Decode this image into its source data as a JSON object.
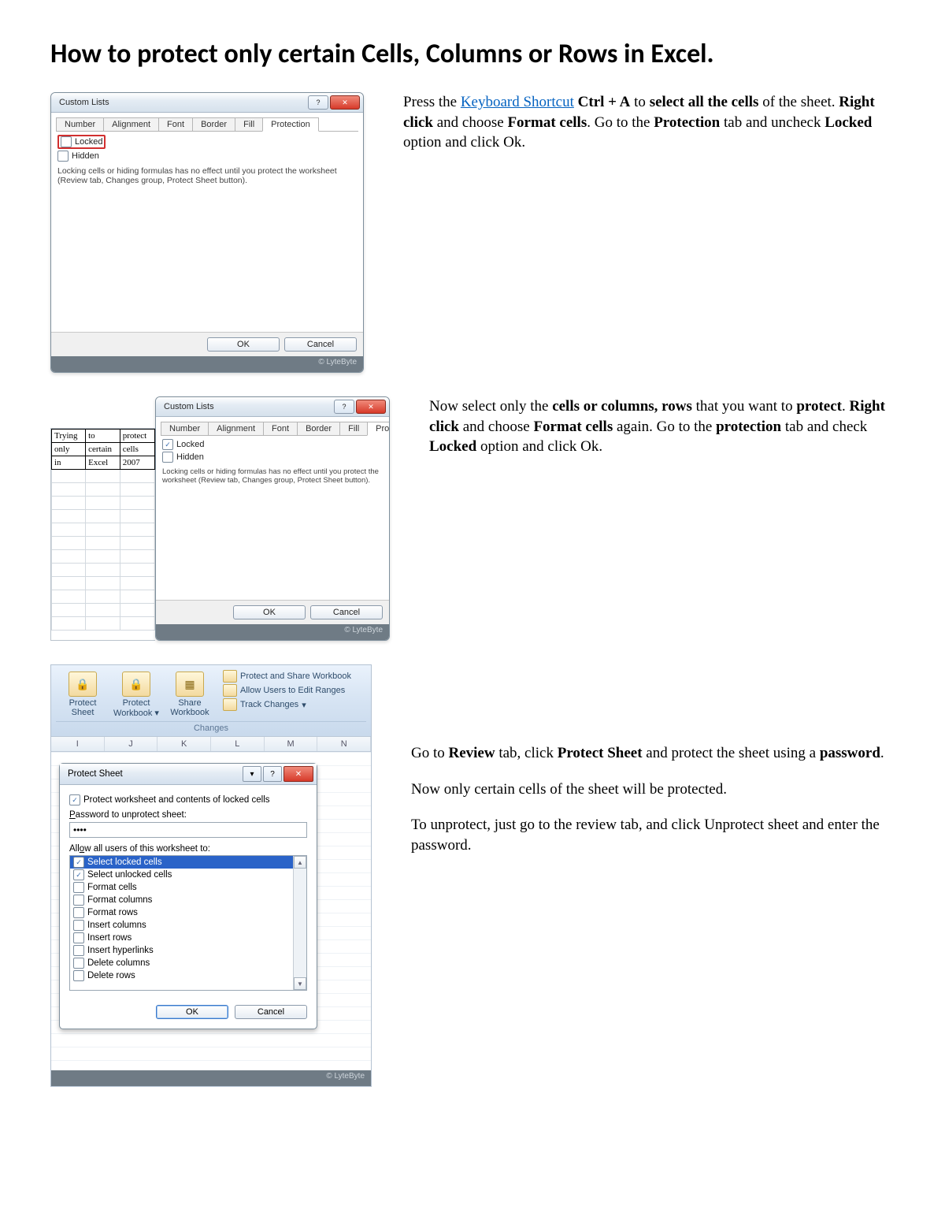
{
  "title": "How to protect only certain Cells, Columns or Rows in Excel.",
  "step1_text": {
    "prefix": "Press the ",
    "link": "Keyboard Shortcut",
    "b1": "Ctrl + A",
    "t1": " to ",
    "b2": "select all the cells",
    "t2": " of the sheet. ",
    "b3": "Right click",
    "t3": " and choose ",
    "b4": "Format cells",
    "t4": ". Go to the ",
    "b5": "Protection",
    "t5": " tab and uncheck ",
    "b6": "Locked",
    "t6": " option and click Ok."
  },
  "step2_text": {
    "t0": "Now select only the ",
    "b1": "cells or columns, rows",
    "t1": " that you want to ",
    "b2": "protect",
    "t2": ". ",
    "b3": "Right click",
    "t3": " and choose ",
    "b4": "Format cells",
    "t4": " again. Go to the ",
    "b5": "protection",
    "t5": " tab and check ",
    "b6": "Locked",
    "t6": " option and click Ok."
  },
  "step3_text": {
    "p1a": "Go to ",
    "p1b1": "Review",
    "p1b": " tab, click ",
    "p1b2": "Protect Sheet",
    "p1c": " and protect the sheet using a ",
    "p1b3": "password",
    "p1d": ".",
    "p2": "Now only certain cells of the sheet will be protected.",
    "p3": "To unprotect, just go to the review tab, and click Unprotect sheet and enter the password."
  },
  "dialog": {
    "title": "Custom Lists",
    "tabs": [
      "Number",
      "Alignment",
      "Font",
      "Border",
      "Fill",
      "Protection"
    ],
    "locked": "Locked",
    "hidden": "Hidden",
    "note": "Locking cells or hiding formulas has no effect until you protect the worksheet (Review tab, Changes group, Protect Sheet button).",
    "ok": "OK",
    "cancel": "Cancel"
  },
  "watermark": "© LyteByte",
  "mini_sheet": [
    [
      "Trying",
      "to",
      "protect"
    ],
    [
      "only",
      "certain",
      "cells"
    ],
    [
      "in",
      "Excel",
      "2007"
    ]
  ],
  "ribbon": {
    "protect_sheet": "Protect Sheet",
    "protect_wb": "Protect Workbook",
    "share_wb": "Share Workbook",
    "side1": "Protect and Share Workbook",
    "side2": "Allow Users to Edit Ranges",
    "side3": "Track Changes",
    "group": "Changes",
    "cols": [
      "I",
      "J",
      "K",
      "L",
      "M",
      "N"
    ]
  },
  "protect_sheet": {
    "title": "Protect Sheet",
    "toggle": "Protect worksheet and contents of locked cells",
    "pw_label": "Password to unprotect sheet:",
    "pw_value": "••••",
    "allow_label": "Allow all users of this worksheet to:",
    "perms": [
      {
        "label": "Select locked cells",
        "checked": true,
        "selected": true
      },
      {
        "label": "Select unlocked cells",
        "checked": true,
        "selected": false
      },
      {
        "label": "Format cells",
        "checked": false,
        "selected": false
      },
      {
        "label": "Format columns",
        "checked": false,
        "selected": false
      },
      {
        "label": "Format rows",
        "checked": false,
        "selected": false
      },
      {
        "label": "Insert columns",
        "checked": false,
        "selected": false
      },
      {
        "label": "Insert rows",
        "checked": false,
        "selected": false
      },
      {
        "label": "Insert hyperlinks",
        "checked": false,
        "selected": false
      },
      {
        "label": "Delete columns",
        "checked": false,
        "selected": false
      },
      {
        "label": "Delete rows",
        "checked": false,
        "selected": false
      }
    ],
    "ok": "OK",
    "cancel": "Cancel"
  }
}
